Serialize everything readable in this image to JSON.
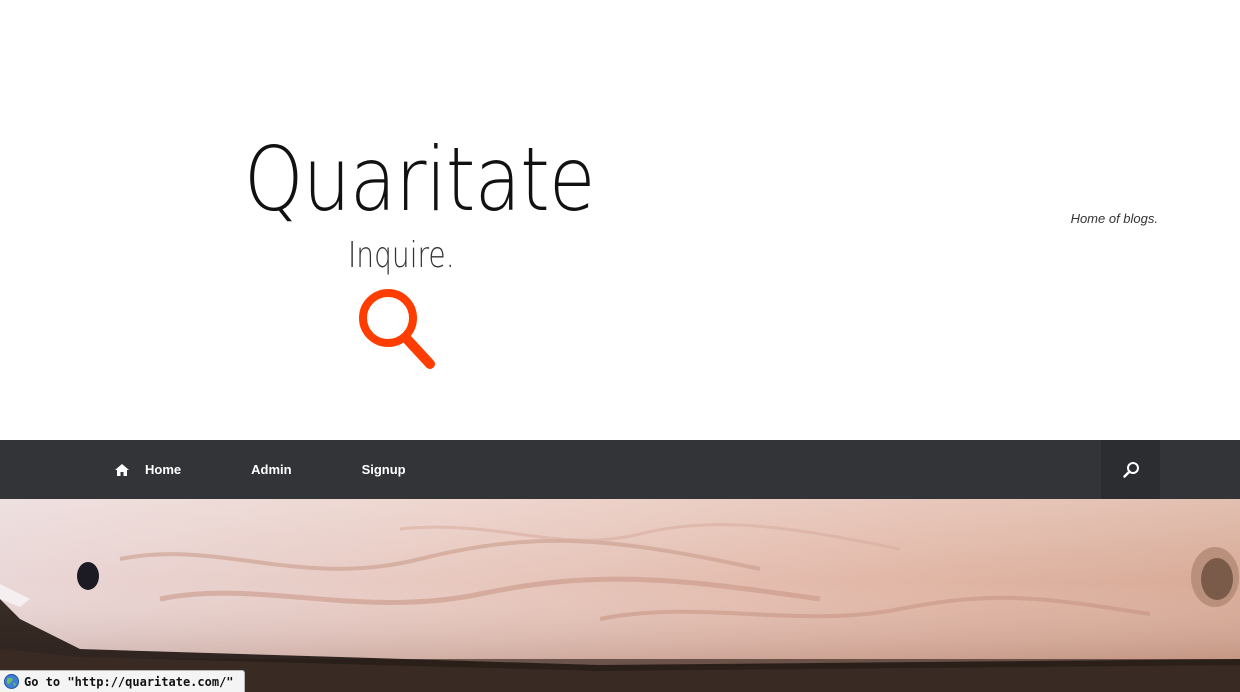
{
  "site": {
    "title": "Quaritate",
    "tagline": "Inquire.",
    "description": "Home of blogs."
  },
  "nav": {
    "items": [
      {
        "label": "Home",
        "icon": "home-icon"
      },
      {
        "label": "Admin"
      },
      {
        "label": "Signup"
      }
    ],
    "search_icon": "search-icon"
  },
  "status": {
    "text": "Go to \"http://quaritate.com/\"",
    "icon": "globe-icon"
  },
  "colors": {
    "accent": "#ff3d00",
    "nav_bg": "#333437",
    "nav_text": "#ffffff"
  }
}
